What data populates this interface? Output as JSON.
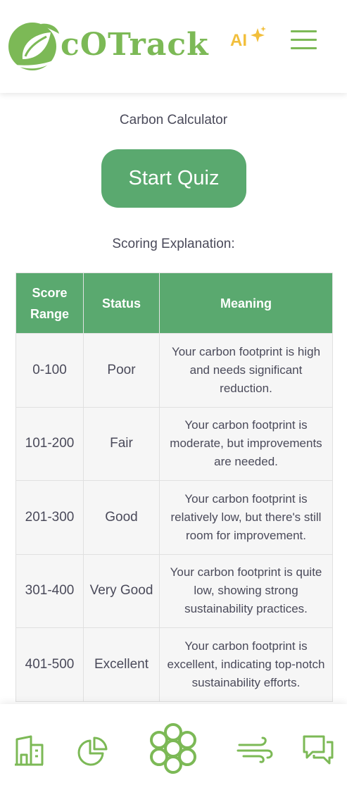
{
  "header": {
    "brand": "cOTrack",
    "ai_label": "AI",
    "icons": {
      "logo": "leaf-logo-icon",
      "ai": "sparkle-icon",
      "menu": "hamburger-menu-icon"
    }
  },
  "main": {
    "page_title": "Carbon Calculator",
    "start_button": "Start Quiz",
    "section_title": "Scoring Explanation:"
  },
  "table": {
    "headers": [
      "Score Range",
      "Status",
      "Meaning"
    ],
    "rows": [
      {
        "range": "0-100",
        "status": "Poor",
        "meaning": "Your carbon footprint is high and needs significant reduction."
      },
      {
        "range": "101-200",
        "status": "Fair",
        "meaning": "Your carbon footprint is moderate, but improvements are needed."
      },
      {
        "range": "201-300",
        "status": "Good",
        "meaning": "Your carbon footprint is relatively low, but there's still room for improvement."
      },
      {
        "range": "301-400",
        "status": "Very Good",
        "meaning": "Your carbon footprint is quite low, showing strong sustainability practices."
      },
      {
        "range": "401-500",
        "status": "Excellent",
        "meaning": "Your carbon footprint is excellent, indicating top-notch sustainability efforts."
      }
    ]
  },
  "bottom_nav": {
    "items": [
      "home-icon",
      "pie-chart-icon",
      "flower-icon",
      "wind-icon",
      "chat-icon"
    ]
  },
  "colors": {
    "brand_green": "#7cb956",
    "table_green": "#5aa96f",
    "ai_yellow": "#f2bf3c",
    "text": "#4a4a5a"
  }
}
